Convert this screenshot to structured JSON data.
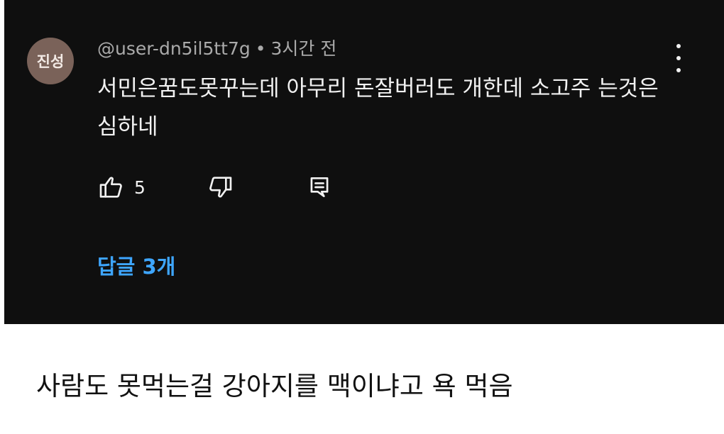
{
  "comment": {
    "avatar_text": "진성",
    "username": "@user-dn5il5tt7g",
    "separator": "•",
    "time": "3시간 전",
    "text": "서민은꿈도못꾸는데 아무리 돈잘버러도 개한데 소고주 는것은 심하네",
    "like_count": "5",
    "replies_label": "답글 3개",
    "icons": [
      "thumbs-up-icon",
      "thumbs-down-icon",
      "reply-icon",
      "more-vert-icon"
    ]
  },
  "caption": "사람도 못먹는걸 강아지를 맥이냐고 욕 먹음",
  "colors": {
    "panel_bg": "#0f0f0f",
    "page_bg": "#ffffff",
    "avatar_bg": "#7a6259",
    "link": "#3ea6ff",
    "meta": "#aaaaaa",
    "text": "#f1f1f1"
  }
}
